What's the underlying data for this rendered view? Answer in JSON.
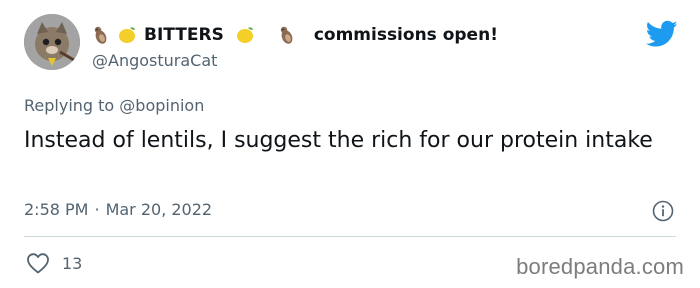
{
  "tweet": {
    "display_name_prefix_emoji": [
      "otter-icon",
      "lemon-icon"
    ],
    "display_name": "BITTERS",
    "display_name_suffix_emoji": [
      "lemon-icon",
      "otter-icon"
    ],
    "name_tagline": "commissions open!",
    "handle": "@AngosturaCat",
    "reply_prefix": "Replying to",
    "reply_target": "@bopinion",
    "text": "Instead of lentils, I suggest the rich for our protein intake",
    "time": "2:58 PM",
    "dot": "·",
    "date": "Mar 20, 2022",
    "like_count": "13"
  },
  "watermark": "boredpanda.com",
  "colors": {
    "twitter_blue": "#1d9bf0",
    "secondary_text": "#536471",
    "divider": "#cfd9de"
  },
  "icons": {
    "logo": "twitter-bird-icon",
    "info": "info-icon",
    "like": "heart-icon"
  }
}
